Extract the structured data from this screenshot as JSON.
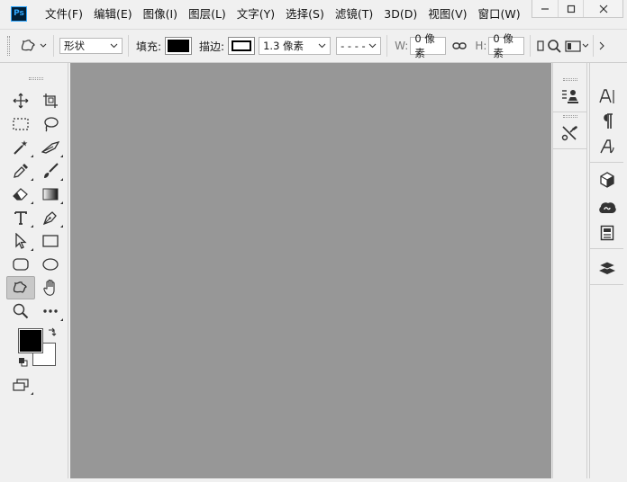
{
  "app": {
    "logo": "Ps"
  },
  "menu": [
    "文件(F)",
    "编辑(E)",
    "图像(I)",
    "图层(L)",
    "文字(Y)",
    "选择(S)",
    "滤镜(T)",
    "3D(D)",
    "视图(V)",
    "窗口(W)",
    "帮"
  ],
  "window_controls": {
    "minimize": "—",
    "maximize": "☐",
    "close": "✕"
  },
  "options": {
    "tool_mode": "形状",
    "fill_label": "填充:",
    "stroke_label": "描边:",
    "stroke_width": "1.3 像素",
    "stroke_type": "- - - -",
    "w_label": "W:",
    "w_value": "0 像素",
    "h_label": "H:",
    "h_value": "0 像素",
    "fill_color": "#000000",
    "stroke_color": "#000000"
  },
  "colors": {
    "foreground": "#000000",
    "background": "#ffffff",
    "canvas": "#979797"
  },
  "tools": [
    "move",
    "artboard",
    "rectangular-marquee",
    "lasso",
    "magic-wand",
    "slice",
    "eyedropper",
    "brush",
    "eraser",
    "gradient",
    "type",
    "pen",
    "path-selection",
    "rectangle",
    "rounded-rectangle",
    "ellipse",
    "custom-shape",
    "hand",
    "zoom",
    "more-tools"
  ],
  "right_panels": [
    "properties",
    "tools-settings",
    "character",
    "paragraph",
    "glyphs",
    "3d",
    "libraries",
    "channels",
    "layers"
  ]
}
